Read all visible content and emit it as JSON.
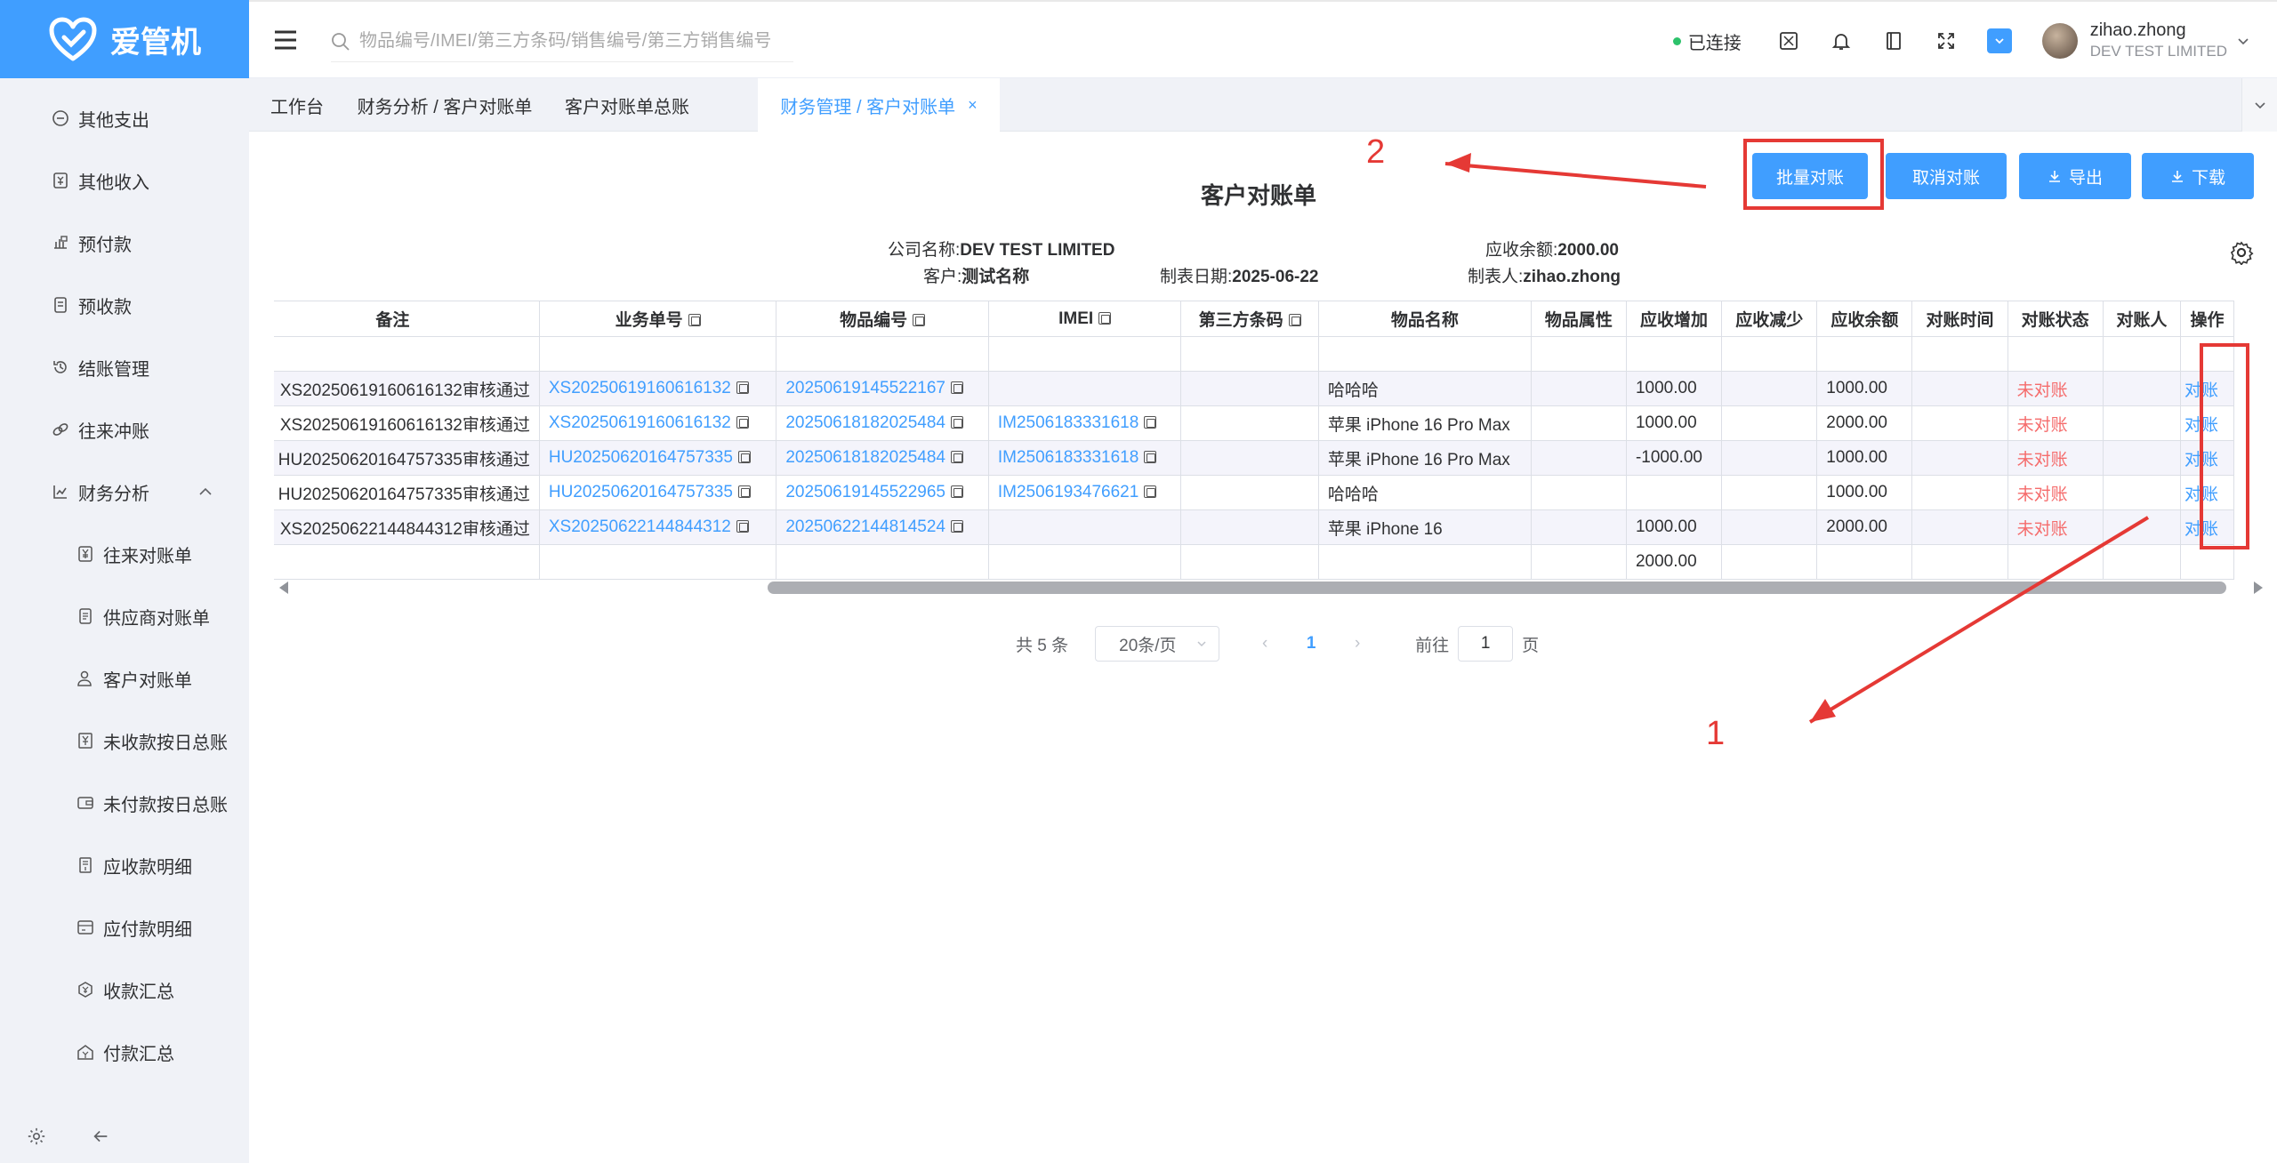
{
  "app": {
    "name": "爱管机"
  },
  "sidebar": {
    "items": [
      {
        "label": "其他支出",
        "icon": "minus-circle-icon"
      },
      {
        "label": "其他收入",
        "icon": "income-icon"
      },
      {
        "label": "预付款",
        "icon": "prepay-icon"
      },
      {
        "label": "预收款",
        "icon": "prereceive-icon"
      },
      {
        "label": "结账管理",
        "icon": "history-icon"
      },
      {
        "label": "往来冲账",
        "icon": "link-icon"
      },
      {
        "label": "财务分析",
        "icon": "chart-icon"
      }
    ],
    "sub_items": [
      {
        "label": "往来对账单",
        "icon": "yen-doc-icon"
      },
      {
        "label": "供应商对账单",
        "icon": "doc-icon"
      },
      {
        "label": "客户对账单",
        "icon": "user-icon"
      },
      {
        "label": "未收款按日总账",
        "icon": "yen-box-icon"
      },
      {
        "label": "未付款按日总账",
        "icon": "wallet-icon"
      },
      {
        "label": "应收款明细",
        "icon": "receipt-icon"
      },
      {
        "label": "应付款明细",
        "icon": "card-icon"
      },
      {
        "label": "收款汇总",
        "icon": "coin-icon"
      },
      {
        "label": "付款汇总",
        "icon": "home-icon"
      }
    ]
  },
  "header": {
    "search_placeholder": "物品编号/IMEI/第三方条码/销售编号/第三方销售编号",
    "status": "已连接",
    "user_name": "zihao.zhong",
    "user_company": "DEV TEST LIMITED"
  },
  "tabs": [
    {
      "label": "工作台"
    },
    {
      "label": "财务分析 / 客户对账单"
    },
    {
      "label": "客户对账单总账"
    },
    {
      "label": "财务管理 / 客户对账单"
    }
  ],
  "toolbar": {
    "batch": "批量对账",
    "cancel": "取消对账",
    "export": "导出",
    "download": "下载"
  },
  "report": {
    "title": "客户对账单",
    "company_label": "公司名称:",
    "company": "DEV TEST LIMITED",
    "balance_label": "应收余额:",
    "balance": "2000.00",
    "customer_label": "客户:",
    "customer": "测试名称",
    "date_label": "制表日期:",
    "date": "2025-06-22",
    "maker_label": "制表人:",
    "maker": "zihao.zhong"
  },
  "table": {
    "columns": [
      "备注",
      "业务单号",
      "物品编号",
      "IMEI",
      "第三方条码",
      "物品名称",
      "物品属性",
      "应收增加",
      "应收减少",
      "应收余额",
      "对账时间",
      "对账状态",
      "对账人",
      "操作"
    ],
    "rows": [
      {
        "note": "XS20250619160616132审核通过",
        "order": "XS20250619160616132",
        "item": "20250619145522167",
        "imei": "",
        "barcode": "",
        "name": "哈哈哈",
        "attr": "",
        "inc": "1000.00",
        "dec": "",
        "bal": "1000.00",
        "time": "",
        "status": "未对账",
        "person": "",
        "op": "对账"
      },
      {
        "note": "XS20250619160616132审核通过",
        "order": "XS20250619160616132",
        "item": "20250618182025484",
        "imei": "IM2506183331618",
        "barcode": "",
        "name": "苹果 iPhone 16 Pro Max",
        "attr": "",
        "inc": "1000.00",
        "dec": "",
        "bal": "2000.00",
        "time": "",
        "status": "未对账",
        "person": "",
        "op": "对账"
      },
      {
        "note": "HU20250620164757335审核通过",
        "order": "HU20250620164757335",
        "item": "20250618182025484",
        "imei": "IM2506183331618",
        "barcode": "",
        "name": "苹果 iPhone 16 Pro Max",
        "attr": "",
        "inc": "-1000.00",
        "dec": "",
        "bal": "1000.00",
        "time": "",
        "status": "未对账",
        "person": "",
        "op": "对账"
      },
      {
        "note": "HU20250620164757335审核通过",
        "order": "HU20250620164757335",
        "item": "20250619145522965",
        "imei": "IM2506193476621",
        "barcode": "",
        "name": "哈哈哈",
        "attr": "",
        "inc": "",
        "dec": "",
        "bal": "1000.00",
        "time": "",
        "status": "未对账",
        "person": "",
        "op": "对账"
      },
      {
        "note": "XS20250622144844312审核通过",
        "order": "XS20250622144844312",
        "item": "20250622144814524",
        "imei": "",
        "barcode": "",
        "name": "苹果 iPhone 16",
        "attr": "",
        "inc": "1000.00",
        "dec": "",
        "bal": "2000.00",
        "time": "",
        "status": "未对账",
        "person": "",
        "op": "对账"
      }
    ],
    "total_inc": "2000.00"
  },
  "pagination": {
    "total": "共 5 条",
    "size": "20条/页",
    "current": "1",
    "goto_label": "前往",
    "goto_value": "1",
    "page_suffix": "页"
  },
  "annotations": {
    "label1": "1",
    "label2": "2",
    "color": "#e53935"
  }
}
